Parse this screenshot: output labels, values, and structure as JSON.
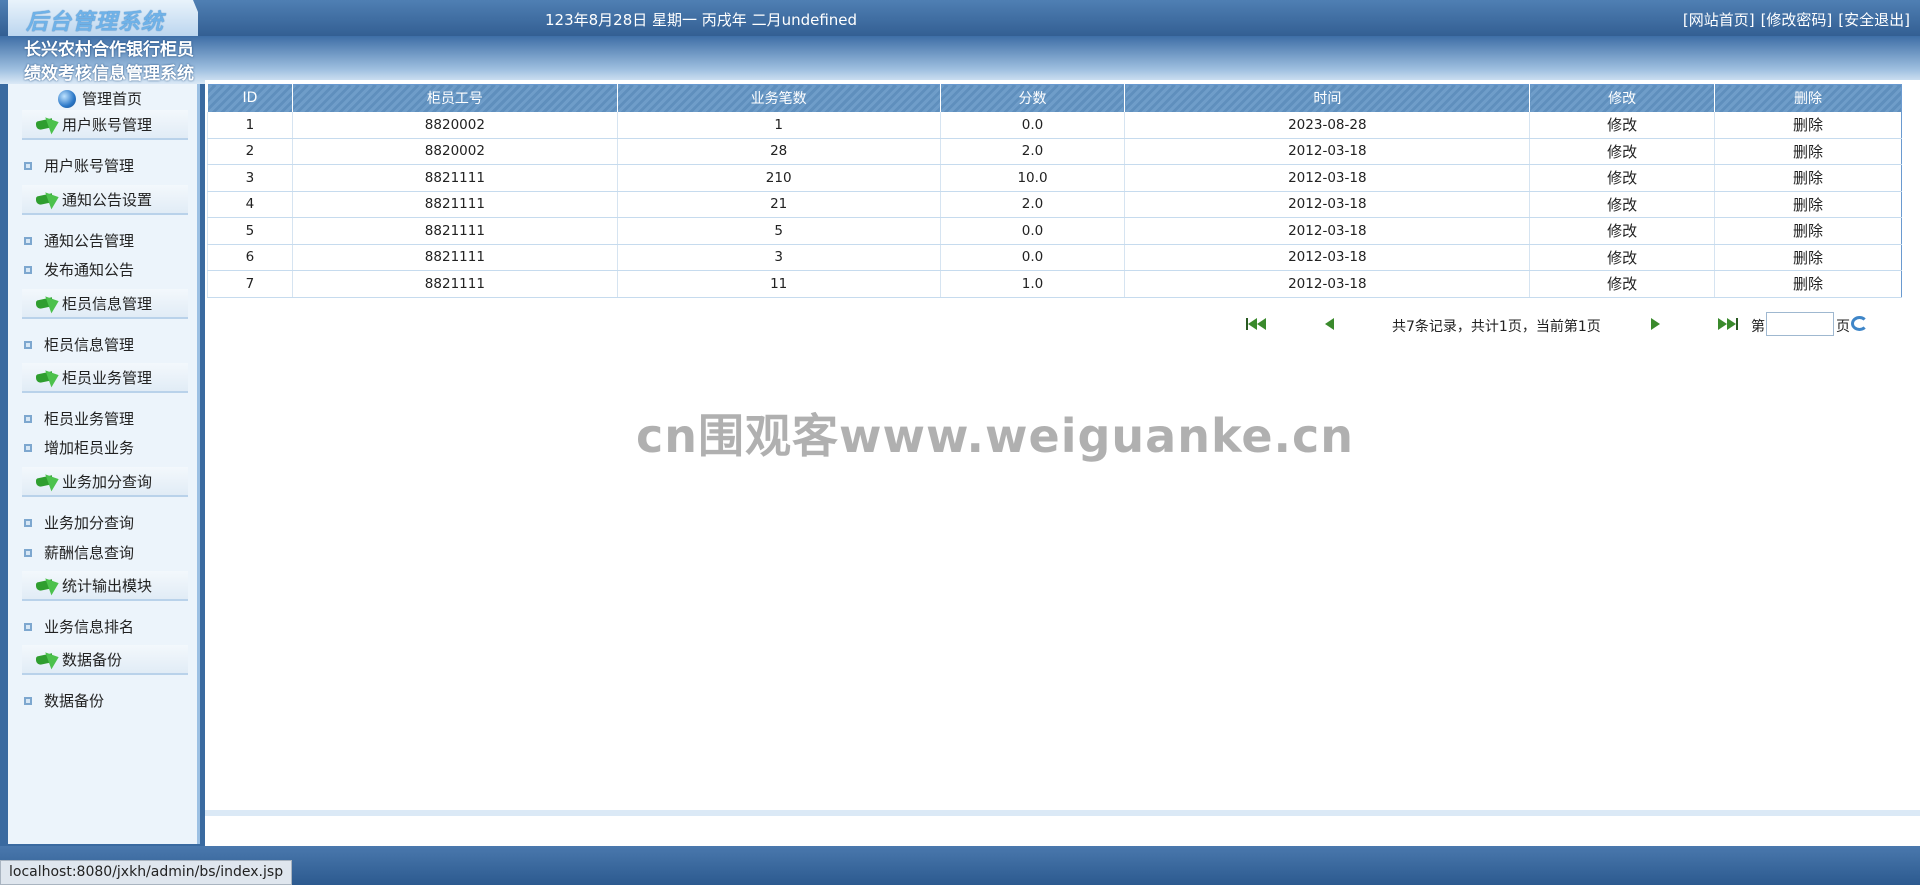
{
  "header": {
    "logo": "后台管理系统",
    "datetime": "123年8月28日 星期一 丙戌年 二月undefined",
    "links": [
      "[网站首页]",
      "[修改密码]",
      "[安全退出]"
    ],
    "system_title": "长兴农村合作银行柜员绩效考核信息管理系统"
  },
  "sidebar": {
    "home": "管理首页",
    "groups": [
      {
        "title": "用户账号管理",
        "items": [
          "用户账号管理"
        ]
      },
      {
        "title": "通知公告设置",
        "items": [
          "通知公告管理",
          "发布通知公告"
        ]
      },
      {
        "title": "柜员信息管理",
        "items": [
          "柜员信息管理"
        ]
      },
      {
        "title": "柜员业务管理",
        "items": [
          "柜员业务管理",
          "增加柜员业务"
        ]
      },
      {
        "title": "业务加分查询",
        "items": [
          "业务加分查询",
          "薪酬信息查询"
        ]
      },
      {
        "title": "统计输出模块",
        "items": [
          "业务信息排名"
        ]
      },
      {
        "title": "数据备份",
        "items": [
          "数据备份"
        ]
      }
    ]
  },
  "table": {
    "columns": [
      "ID",
      "柜员工号",
      "业务笔数",
      "分数",
      "时间",
      "修改",
      "删除"
    ],
    "rows": [
      [
        "1",
        "8820002",
        "1",
        "0.0",
        "2023-08-28",
        "修改",
        "删除"
      ],
      [
        "2",
        "8820002",
        "28",
        "2.0",
        "2012-03-18",
        "修改",
        "删除"
      ],
      [
        "3",
        "8821111",
        "210",
        "10.0",
        "2012-03-18",
        "修改",
        "删除"
      ],
      [
        "4",
        "8821111",
        "21",
        "2.0",
        "2012-03-18",
        "修改",
        "删除"
      ],
      [
        "5",
        "8821111",
        "5",
        "0.0",
        "2012-03-18",
        "修改",
        "删除"
      ],
      [
        "6",
        "8821111",
        "3",
        "0.0",
        "2012-03-18",
        "修改",
        "删除"
      ],
      [
        "7",
        "8821111",
        "11",
        "1.0",
        "2012-03-18",
        "修改",
        "删除"
      ]
    ]
  },
  "pager": {
    "summary": "共7条记录，共计1页，当前第1页",
    "page_prefix": "第",
    "page_suffix": "页",
    "page_value": ""
  },
  "watermark": "cn围观客www.weiguanke.cn",
  "statusbar": "localhost:8080/jxkh/admin/bs/index.jsp",
  "colors": {
    "accent": "#3a6aa0",
    "table_header": "#6f9dc9",
    "nav_green": "#3a8a2c"
  }
}
